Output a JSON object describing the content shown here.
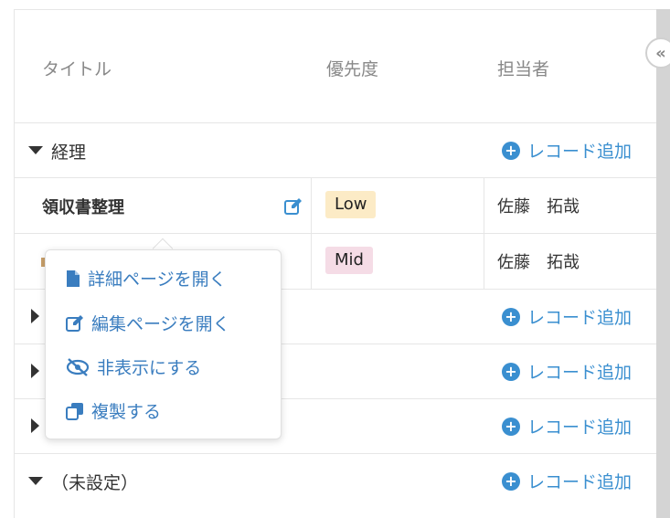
{
  "header": {
    "col_title": "タイトル",
    "col_priority": "優先度",
    "col_assignee": "担当者"
  },
  "groups": {
    "g1": {
      "label": "経理",
      "expanded": true,
      "add_label": "レコード追加"
    },
    "g2": {
      "label": "",
      "expanded": false,
      "add_label": "レコード追加"
    },
    "g3": {
      "label": "",
      "expanded": false,
      "add_label": "レコード追加"
    },
    "g4": {
      "label": "",
      "expanded": false,
      "add_label": "レコード追加"
    },
    "g5": {
      "label": "（未設定）",
      "expanded": true,
      "add_label": "レコード追加"
    }
  },
  "rows": [
    {
      "title": "領収書整理",
      "priority": "Low",
      "assignee": "佐藤　拓哉"
    },
    {
      "title": "",
      "priority": "Mid",
      "assignee": "佐藤　拓哉"
    }
  ],
  "context_menu": {
    "open_detail": "詳細ページを開く",
    "open_edit": "編集ページを開く",
    "hide": "非表示にする",
    "duplicate": "複製する"
  },
  "colors": {
    "accent": "#3a8fd0",
    "badge_low": "#fcebc6",
    "badge_mid": "#f5dce6"
  }
}
